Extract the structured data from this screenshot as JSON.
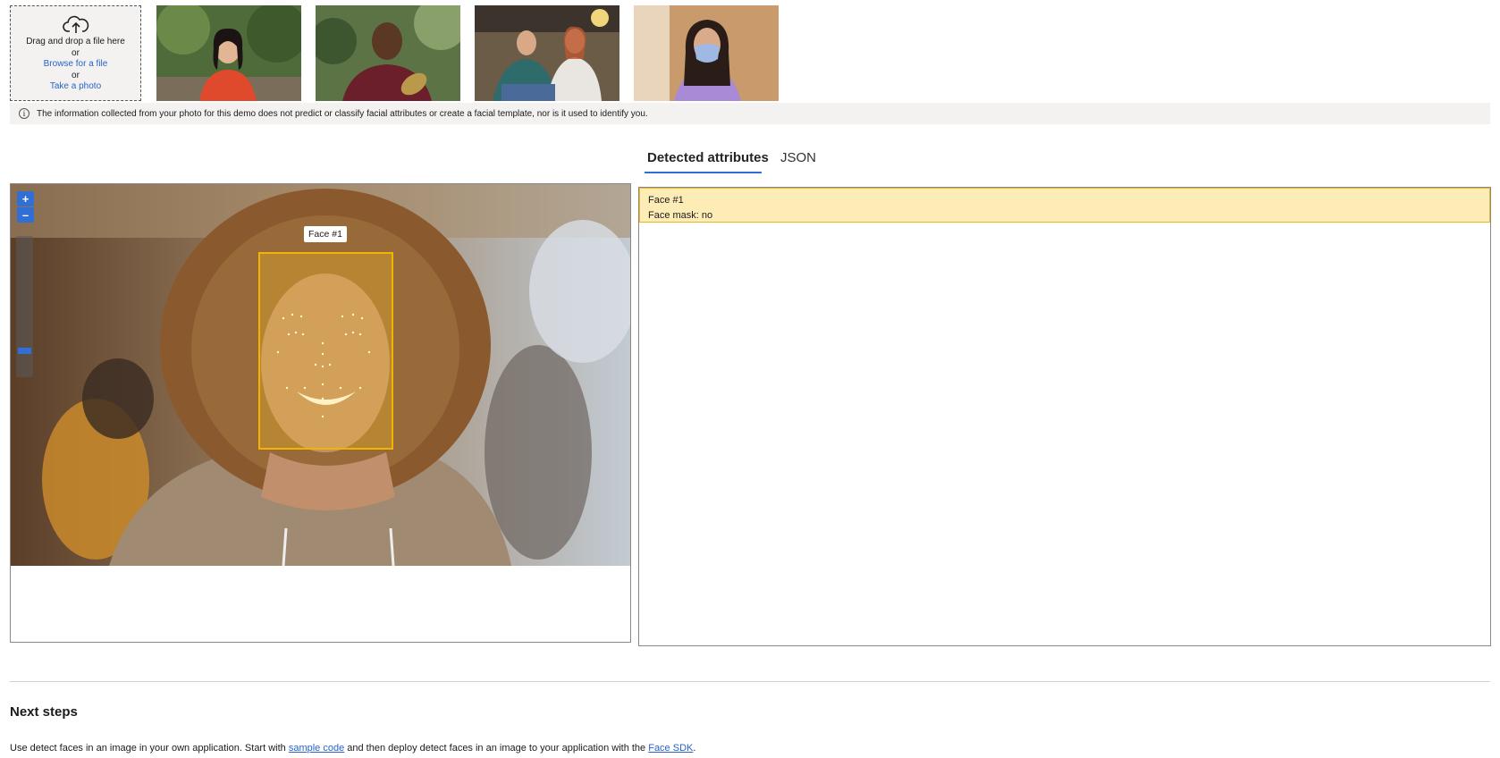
{
  "upload": {
    "drag_text": "Drag and drop a file here",
    "or1": "or",
    "browse_link": "Browse for a file",
    "or2": "or",
    "photo_link": "Take a photo",
    "icon": "cloud-upload-icon"
  },
  "samples": {
    "thumbnails": [
      {
        "name": "sample-woman-red-top"
      },
      {
        "name": "sample-man-maroon-shirt"
      },
      {
        "name": "sample-two-women-seated"
      },
      {
        "name": "sample-woman-face-mask"
      }
    ]
  },
  "notice": {
    "icon": "info-icon",
    "text": "The information collected from your photo for this demo does not predict or classify facial attributes or create a facial template, nor is it used to identify you."
  },
  "tabs": {
    "active": "Detected attributes",
    "other": "JSON"
  },
  "viewer": {
    "zoom_in": "+",
    "zoom_out": "–",
    "zoom_level": 0.17,
    "face_label": "Face #1",
    "colors": {
      "accent": "#2f6fd6",
      "face_box": "#f2b400"
    }
  },
  "attributes": {
    "faces": [
      {
        "title": "Face #1",
        "line": "Face mask: no"
      }
    ]
  },
  "next_steps": {
    "title": "Next steps",
    "text_1": "Use detect faces in an image in your own application. Start with ",
    "link_1": "sample code",
    "text_2": " and then deploy detect faces in an image to your application with the ",
    "link_2": "Face SDK",
    "text_3": "."
  }
}
